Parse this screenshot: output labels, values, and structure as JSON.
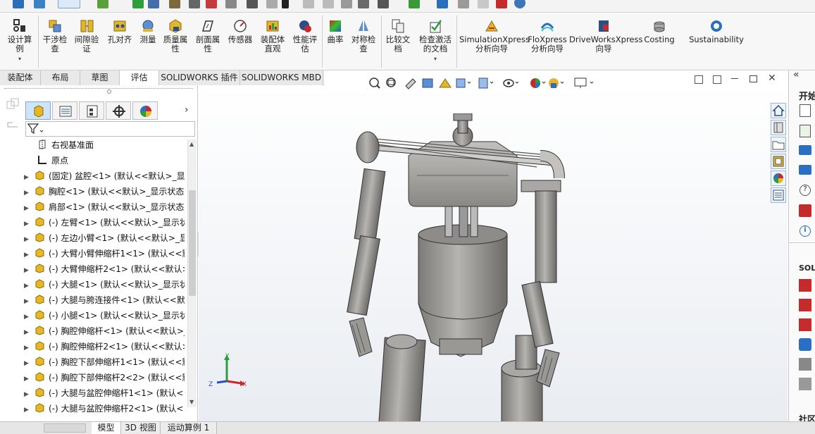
{
  "commands": [
    {
      "label": "设计算\n例",
      "icon": "design-study-icon",
      "dropdown": true
    },
    {
      "label": "干涉检\n查",
      "icon": "interference-check-icon"
    },
    {
      "label": "间隙验\n证",
      "icon": "clearance-verification-icon"
    },
    {
      "label": "孔对齐",
      "icon": "hole-alignment-icon"
    },
    {
      "label": "测量",
      "icon": "measure-icon"
    },
    {
      "label": "质量属\n性",
      "icon": "mass-properties-icon"
    },
    {
      "label": "剖面属\n性",
      "icon": "section-properties-icon"
    },
    {
      "label": "传感器",
      "icon": "sensor-icon"
    },
    {
      "label": "装配体\n直观",
      "icon": "assembly-visualization-icon"
    },
    {
      "label": "性能评\n估",
      "icon": "performance-evaluation-icon"
    },
    {
      "label": "曲率",
      "icon": "curvature-icon"
    },
    {
      "label": "对称检\n查",
      "icon": "symmetry-check-icon"
    },
    {
      "label": "比较文\n档",
      "icon": "compare-documents-icon"
    },
    {
      "label": "检查激活\n的文档",
      "icon": "check-active-document-icon",
      "dropdown": true
    },
    {
      "label": "SimulationXpress\n分析向导",
      "icon": "simulationxpress-icon"
    },
    {
      "label": "FloXpress\n分析向导",
      "icon": "floxpress-icon"
    },
    {
      "label": "DriveWorksXpress\n向导",
      "icon": "driveworksxpress-icon"
    },
    {
      "label": "Costing",
      "icon": "costing-icon"
    },
    {
      "label": "Sustainability",
      "icon": "sustainability-icon"
    }
  ],
  "tabs": [
    "装配体",
    "布局",
    "草图",
    "评估",
    "SOLIDWORKS 插件",
    "SOLIDWORKS MBD"
  ],
  "active_tab": "评估",
  "tree": [
    {
      "text": "右视基准面",
      "icon": "plane-icon",
      "expandable": false
    },
    {
      "text": "原点",
      "icon": "origin-icon",
      "expandable": false
    },
    {
      "text": "(固定) 盆腔<1> (默认<<默认>_显示",
      "icon": "part-icon",
      "expandable": true
    },
    {
      "text": "胸腔<1> (默认<<默认>_显示状态",
      "icon": "part-icon",
      "expandable": true
    },
    {
      "text": "肩部<1> (默认<<默认>_显示状态",
      "icon": "part-icon",
      "expandable": true
    },
    {
      "text": "(-) 左臂<1> (默认<<默认>_显示状",
      "icon": "part-icon",
      "expandable": true
    },
    {
      "text": "(-) 左边小臂<1> (默认<<默认>_显",
      "icon": "part-icon",
      "expandable": true
    },
    {
      "text": "(-) 大臂小臂伸缩杆1<1> (默认<<默",
      "icon": "part-icon",
      "expandable": true
    },
    {
      "text": "(-) 大臂伸缩杆2<1> (默认<<默认>",
      "icon": "part-icon",
      "expandable": true
    },
    {
      "text": "(-) 大腿<1> (默认<<默认>_显示状",
      "icon": "part-icon",
      "expandable": true
    },
    {
      "text": "(-) 大腿与胯连接件<1> (默认<<默",
      "icon": "part-icon",
      "expandable": true
    },
    {
      "text": "(-) 小腿<1> (默认<<默认>_显示状",
      "icon": "part-icon",
      "expandable": true
    },
    {
      "text": "(-) 胸腔伸缩杆<1> (默认<<默认>_",
      "icon": "part-icon",
      "expandable": true
    },
    {
      "text": "(-) 胸腔伸缩杆2<1> (默认<<默认>",
      "icon": "part-icon",
      "expandable": true
    },
    {
      "text": "(-) 胸腔下部伸缩杆1<1> (默认<<默",
      "icon": "part-icon",
      "expandable": true
    },
    {
      "text": "(-) 胸腔下部伸缩杆2<2> (默认<<默",
      "icon": "part-icon",
      "expandable": true
    },
    {
      "text": "(-) 大腿与盆腔伸缩杆1<1> (默认<",
      "icon": "part-icon",
      "expandable": true
    },
    {
      "text": "(-) 大腿与盆腔伸缩杆2<1> (默认<",
      "icon": "part-icon",
      "expandable": true
    }
  ],
  "bottom_tabs": [
    "模型",
    "3D 视图",
    "运动算例 1"
  ],
  "active_bottom_tab": "模型",
  "right_panel": {
    "header": "开始",
    "section": "SOLI",
    "footer": "社区"
  },
  "triad_labels": {
    "x": "X",
    "y": "Y",
    "z": "Z"
  },
  "colors": {
    "accent": "#2a6fc2",
    "part_yellow": "#e8b820",
    "model_gray": "#9c9a96"
  }
}
